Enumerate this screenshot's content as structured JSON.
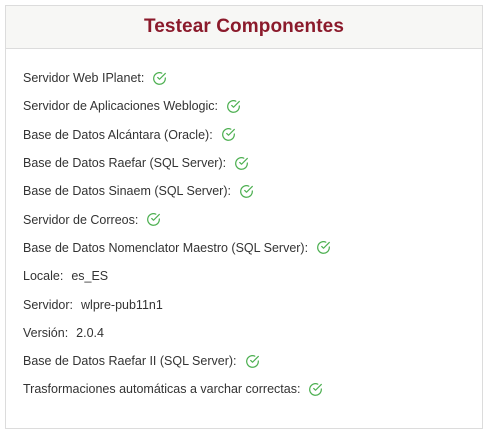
{
  "panel": {
    "title": "Testear Componentes"
  },
  "colors": {
    "title": "#8b1a2b",
    "check": "#4caf50"
  },
  "rows": [
    {
      "label": "Servidor Web IPlanet:",
      "status": "ok"
    },
    {
      "label": "Servidor de Aplicaciones Weblogic:",
      "status": "ok"
    },
    {
      "label": "Base de Datos Alcántara (Oracle):",
      "status": "ok"
    },
    {
      "label": "Base de Datos Raefar (SQL Server):",
      "status": "ok"
    },
    {
      "label": "Base de Datos Sinaem (SQL Server):",
      "status": "ok"
    },
    {
      "label": "Servidor de Correos:",
      "status": "ok"
    },
    {
      "label": "Base de Datos Nomenclator Maestro (SQL Server):",
      "status": "ok"
    },
    {
      "label": "Locale:",
      "value": "es_ES"
    },
    {
      "label": "Servidor:",
      "value": "wlpre-pub11n1"
    },
    {
      "label": "Versión:",
      "value": "2.0.4"
    },
    {
      "label": "Base de Datos Raefar II (SQL Server):",
      "status": "ok"
    },
    {
      "label": "Trasformaciones automáticas a varchar correctas:",
      "status": "ok"
    }
  ],
  "icons": {
    "ok": "check-circle-icon"
  }
}
